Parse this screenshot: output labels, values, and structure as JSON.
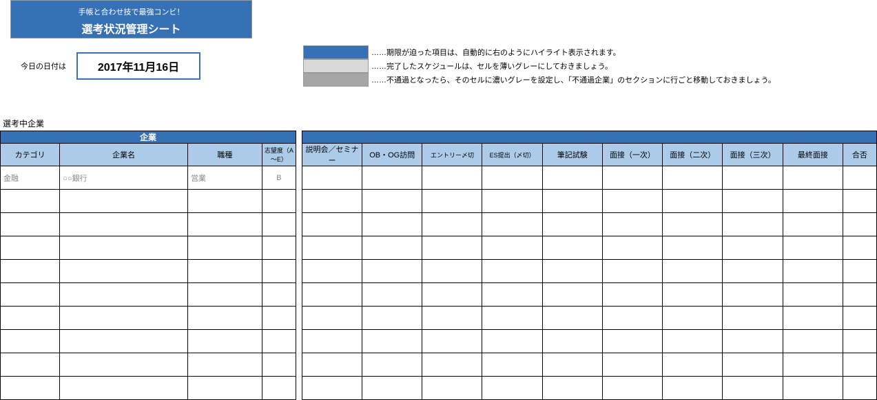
{
  "title": {
    "sub": "手帳と合わせ技で最強コンビ！",
    "main": "選考状況管理シート"
  },
  "date": {
    "label": "今日の日付は",
    "value": "2017年11月16日"
  },
  "legend": {
    "items": [
      {
        "text": "……期限が迫った項目は、自動的に右のようにハイライト表示されます。"
      },
      {
        "text": "……完了したスケジュールは、セルを薄いグレーにしておきましょう。"
      },
      {
        "text": "……不通過となったら、そのセルに濃いグレーを設定し、「不通過企業」のセクションに行ごと移動しておきましょう。"
      }
    ]
  },
  "section_label": "選考中企業",
  "headers": {
    "group_company": "企業",
    "category": "カテゴリ",
    "company_name": "企業名",
    "job_type": "職種",
    "rank": "志望度（A～E）",
    "seminar": "説明会／セミナー",
    "obog": "OB・OG訪問",
    "entry": "エントリー〆切",
    "es": "ES提出（〆切）",
    "written": "筆記試験",
    "interview1": "面接（一次）",
    "interview2": "面接（二次）",
    "interview3": "面接（三次）",
    "final": "最終面接",
    "result": "合否"
  },
  "rows": [
    {
      "category": "金融",
      "company_name": "○○銀行",
      "job_type": "営業",
      "rank": "B"
    },
    {},
    {},
    {},
    {},
    {},
    {},
    {},
    {},
    {}
  ]
}
